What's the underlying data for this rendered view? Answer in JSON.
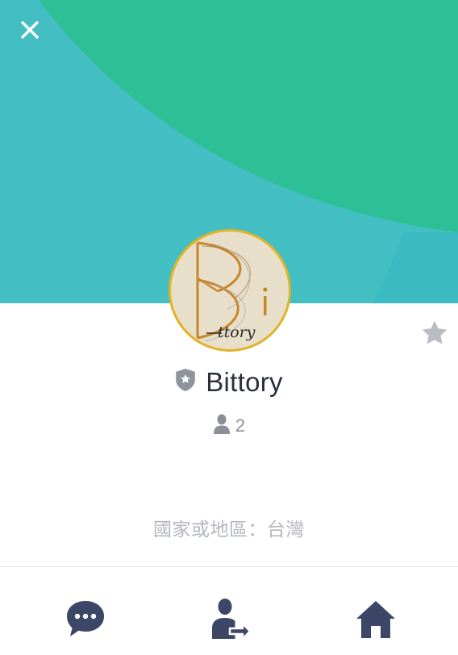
{
  "header": {
    "close_icon": "close-icon",
    "colors": {
      "teal": "#43bfc3",
      "green": "#2dbf96",
      "close": "#ffffff"
    }
  },
  "profile": {
    "avatar_icon": "bittory-logo",
    "avatar_logo_text": "Bi ttory",
    "name": "Bittory",
    "official_badge_icon": "shield-star-icon",
    "member_icon": "person-icon",
    "member_count": "2",
    "region": "國家或地區：台灣",
    "favorite_icon": "star-icon"
  },
  "bottom_nav": {
    "items": [
      {
        "icon": "chat-bubble-icon",
        "label": ""
      },
      {
        "icon": "share-contact-icon",
        "label": ""
      },
      {
        "icon": "home-icon",
        "label": ""
      }
    ],
    "icon_color": "#3c4667"
  }
}
